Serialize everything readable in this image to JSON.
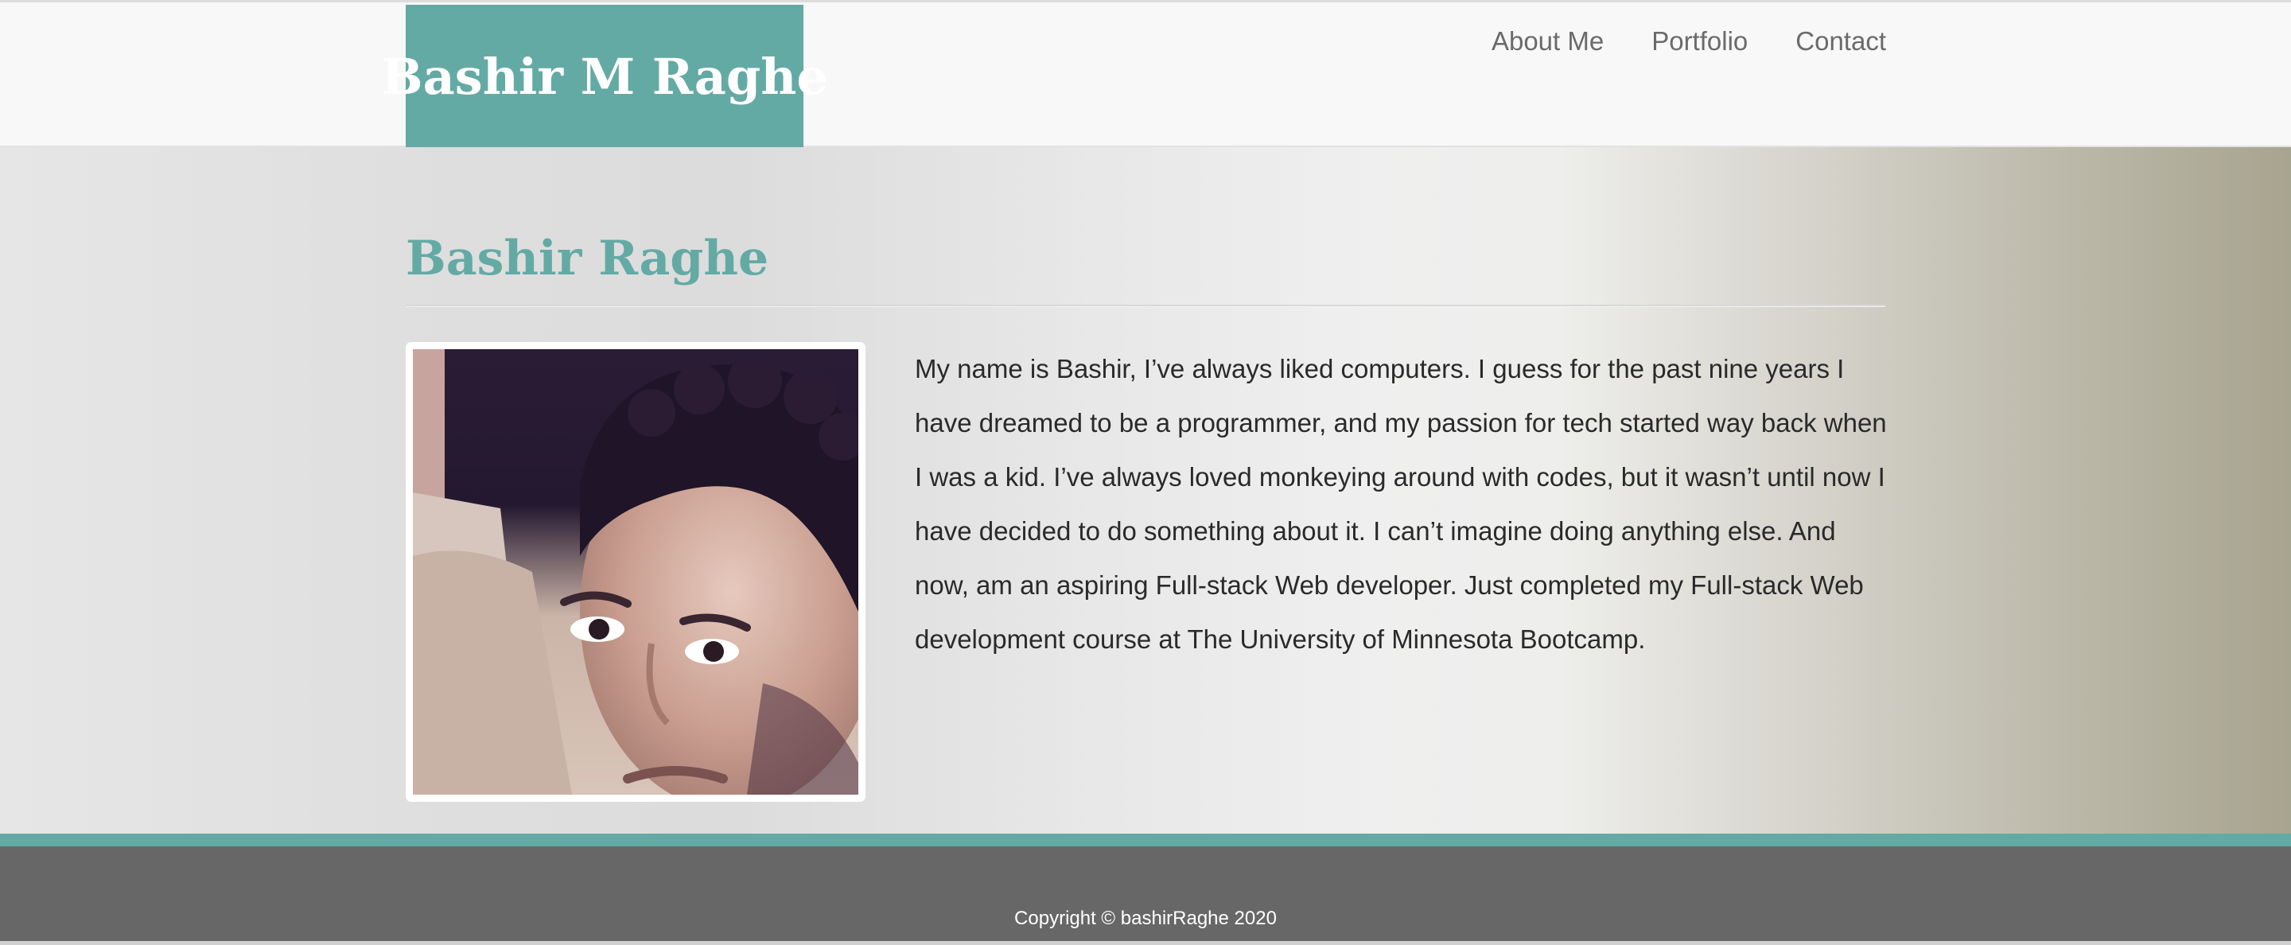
{
  "header": {
    "brand": "Bashir M Raghe",
    "nav": [
      {
        "label": "About Me"
      },
      {
        "label": "Portfolio"
      },
      {
        "label": "Contact"
      }
    ]
  },
  "main": {
    "title": "Bashir Raghe",
    "photo_icon": "profile-photo",
    "bio": "My name is Bashir, I’ve always liked computers. I guess for the past nine years I have dreamed to be a programmer, and my passion for tech started way back when I was a kid. I’ve always loved monkeying around with codes, but it wasn’t until now I have decided to do something about it. I can’t imagine doing anything else. And now, am an aspiring Full-stack Web developer. Just completed my Full-stack Web development course at The University of Minnesota Bootcamp."
  },
  "footer": {
    "copyright": "Copyright © bashirRaghe 2020"
  },
  "colors": {
    "accent": "#64aaa4",
    "footer_bg": "#676767",
    "nav_text": "#6a6a6a"
  }
}
